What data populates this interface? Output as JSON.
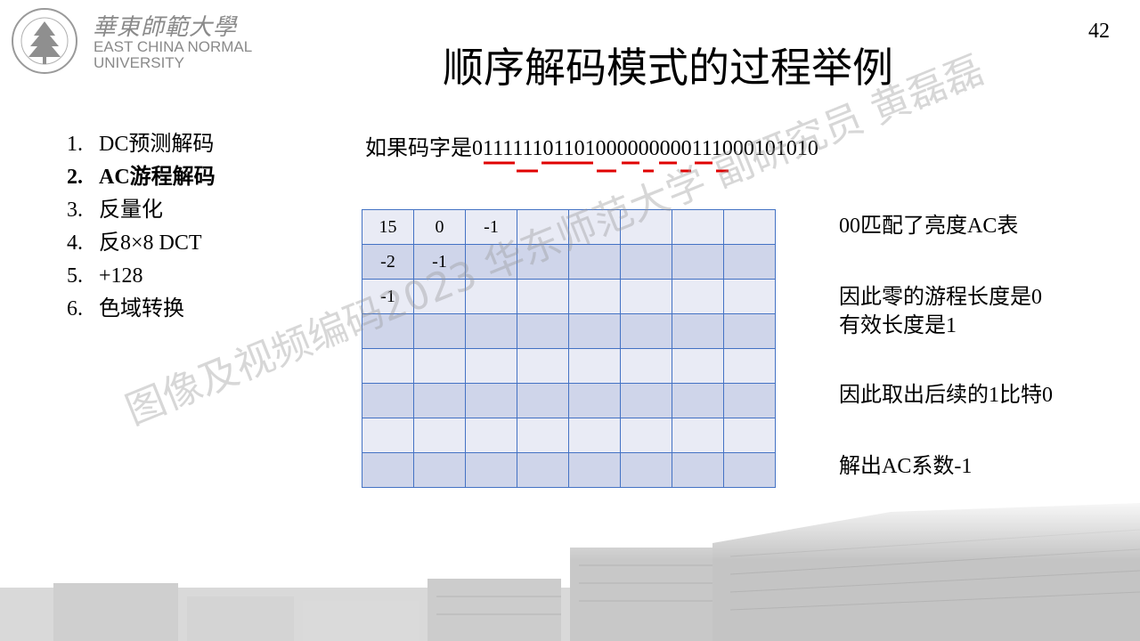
{
  "logo": {
    "name_cn": "華東師範大學",
    "name_en_line1": "EAST CHINA NORMAL",
    "name_en_line2": "UNIVERSITY"
  },
  "page_number": "42",
  "title": "顺序解码模式的过程举例",
  "steps": [
    {
      "num": "1.",
      "label": "DC预测解码"
    },
    {
      "num": "2.",
      "label": "AC游程解码"
    },
    {
      "num": "3.",
      "label": "反量化"
    },
    {
      "num": "4.",
      "label": "反8×8 DCT"
    },
    {
      "num": "5.",
      "label": "+128"
    },
    {
      "num": "6.",
      "label": "色域转换"
    }
  ],
  "codeword": {
    "prefix": "如果码字是",
    "bits": "011111101101000000000111000101010"
  },
  "coefficient_grid": [
    [
      "15",
      "0",
      "-1",
      "",
      "",
      "",
      "",
      ""
    ],
    [
      "-2",
      "-1",
      "",
      "",
      "",
      "",
      "",
      ""
    ],
    [
      "-1",
      "",
      "",
      "",
      "",
      "",
      "",
      ""
    ],
    [
      "",
      "",
      "",
      "",
      "",
      "",
      "",
      ""
    ],
    [
      "",
      "",
      "",
      "",
      "",
      "",
      "",
      ""
    ],
    [
      "",
      "",
      "",
      "",
      "",
      "",
      "",
      ""
    ],
    [
      "",
      "",
      "",
      "",
      "",
      "",
      "",
      ""
    ],
    [
      "",
      "",
      "",
      "",
      "",
      "",
      "",
      ""
    ]
  ],
  "notes": {
    "match": "00匹配了亮度AC表",
    "run_length": "因此零的游程长度是0",
    "effective_length": "有效长度是1",
    "take_bit": "因此取出后续的1比特0",
    "result": "解出AC系数-1"
  },
  "watermark": "图像及视频编码2023 华东师范大学 副研究员 黄磊磊",
  "colors": {
    "grid_border": "#4472c4",
    "grid_light": "#e9ebf5",
    "grid_dark": "#cfd5ea",
    "underline": "#e00000"
  }
}
